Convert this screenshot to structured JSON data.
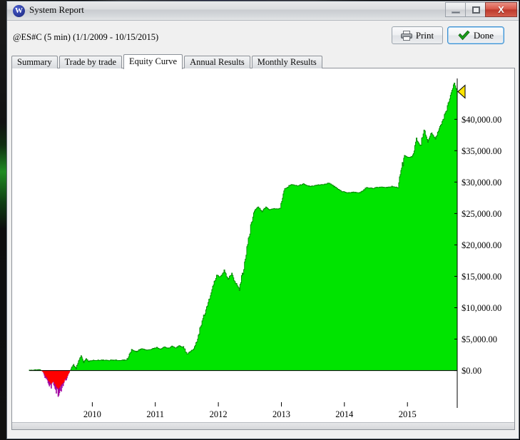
{
  "window": {
    "title": "System Report",
    "app_icon": "w-logo-icon",
    "buttons": {
      "minimize": "minimize-icon",
      "maximize": "restore-icon",
      "close_label": "X"
    }
  },
  "header": {
    "symbol_line": "@ES#C (5 min)  (1/1/2009 - 10/15/2015)",
    "print_label": "Print",
    "done_label": "Done"
  },
  "tabs": [
    {
      "label": "Summary",
      "active": false
    },
    {
      "label": "Trade by trade",
      "active": false
    },
    {
      "label": "Equity Curve",
      "active": true
    },
    {
      "label": "Annual Results",
      "active": false
    },
    {
      "label": "Monthly Results",
      "active": false
    }
  ],
  "colors": {
    "equity_fill": "#00e400",
    "equity_outline": "#008a00",
    "drawdown_fill": "#ff0000",
    "drawdown_deep": "#a000a0",
    "axis": "#000000",
    "end_marker": "#ffe400",
    "panel_bg": "#ffffff"
  },
  "chart_data": {
    "type": "area",
    "title": "Equity Curve",
    "xlabel": "",
    "ylabel": "",
    "grid": false,
    "legend": false,
    "x_ticklabels": [
      "2010",
      "2011",
      "2012",
      "2013",
      "2014",
      "2015"
    ],
    "x_tickvalues": [
      2010,
      2011,
      2012,
      2013,
      2014,
      2015
    ],
    "xlim": [
      2009.0,
      2015.79
    ],
    "y_ticklabels": [
      "$0.00",
      "$5,000.00",
      "$10,000.00",
      "$15,000.00",
      "$20,000.00",
      "$25,000.00",
      "$30,000.00",
      "$35,000.00",
      "$40,000.00"
    ],
    "y_tickvalues": [
      0,
      5000,
      10000,
      15000,
      20000,
      25000,
      30000,
      35000,
      40000
    ],
    "ylim": [
      -3000,
      46500
    ],
    "zero_line": 0,
    "end_marker_label": "end-of-curve-marker",
    "series": [
      {
        "name": "Equity",
        "x": [
          2009.0,
          2009.08,
          2009.14,
          2009.18,
          2009.22,
          2009.26,
          2009.3,
          2009.34,
          2009.38,
          2009.42,
          2009.46,
          2009.5,
          2009.54,
          2009.58,
          2009.62,
          2009.66,
          2009.7,
          2009.74,
          2009.78,
          2009.82,
          2009.86,
          2009.9,
          2009.94,
          2009.98,
          2010.05,
          2010.15,
          2010.25,
          2010.35,
          2010.45,
          2010.55,
          2010.62,
          2010.7,
          2010.78,
          2010.86,
          2010.94,
          2011.02,
          2011.08,
          2011.14,
          2011.2,
          2011.26,
          2011.32,
          2011.38,
          2011.44,
          2011.5,
          2011.56,
          2011.62,
          2011.68,
          2011.74,
          2011.8,
          2011.86,
          2011.92,
          2011.97,
          2012.03,
          2012.09,
          2012.15,
          2012.21,
          2012.27,
          2012.33,
          2012.39,
          2012.45,
          2012.51,
          2012.57,
          2012.63,
          2012.69,
          2012.75,
          2012.81,
          2012.87,
          2012.93,
          2012.98,
          2013.05,
          2013.15,
          2013.25,
          2013.35,
          2013.45,
          2013.55,
          2013.65,
          2013.75,
          2013.85,
          2013.95,
          2014.05,
          2014.15,
          2014.25,
          2014.35,
          2014.45,
          2014.55,
          2014.65,
          2014.75,
          2014.85,
          2014.95,
          2015.02,
          2015.08,
          2015.14,
          2015.2,
          2015.26,
          2015.32,
          2015.38,
          2015.44,
          2015.5,
          2015.56,
          2015.62,
          2015.68,
          2015.74,
          2015.79
        ],
        "y": [
          0,
          60,
          120,
          60,
          -300,
          -900,
          -1500,
          -2100,
          -1700,
          -2400,
          -2900,
          -2300,
          -1800,
          -1200,
          -500,
          300,
          900,
          400,
          1500,
          2300,
          1200,
          1900,
          1400,
          1600,
          1600,
          1650,
          1600,
          1650,
          1600,
          1700,
          3300,
          3000,
          3500,
          3200,
          3400,
          3700,
          3400,
          3800,
          3500,
          3900,
          3600,
          3950,
          3700,
          2600,
          3100,
          3500,
          5600,
          7900,
          9600,
          11500,
          13600,
          15200,
          14800,
          15900,
          14600,
          15400,
          13900,
          13100,
          15800,
          19600,
          22800,
          25400,
          26100,
          25300,
          26000,
          25600,
          25800,
          25700,
          25900,
          28900,
          29600,
          29400,
          29700,
          29300,
          29500,
          29600,
          29800,
          29200,
          28500,
          28300,
          28400,
          28300,
          29100,
          29000,
          29200,
          29100,
          29300,
          29100,
          34200,
          33900,
          34100,
          36900,
          35600,
          38200,
          36400,
          37800,
          36900,
          38500,
          39900,
          41600,
          43900,
          45600,
          44400
        ]
      }
    ],
    "annotations": [
      {
        "name": "drawdown-region",
        "text": "initial drawdown below zero (red / purple)"
      }
    ]
  }
}
